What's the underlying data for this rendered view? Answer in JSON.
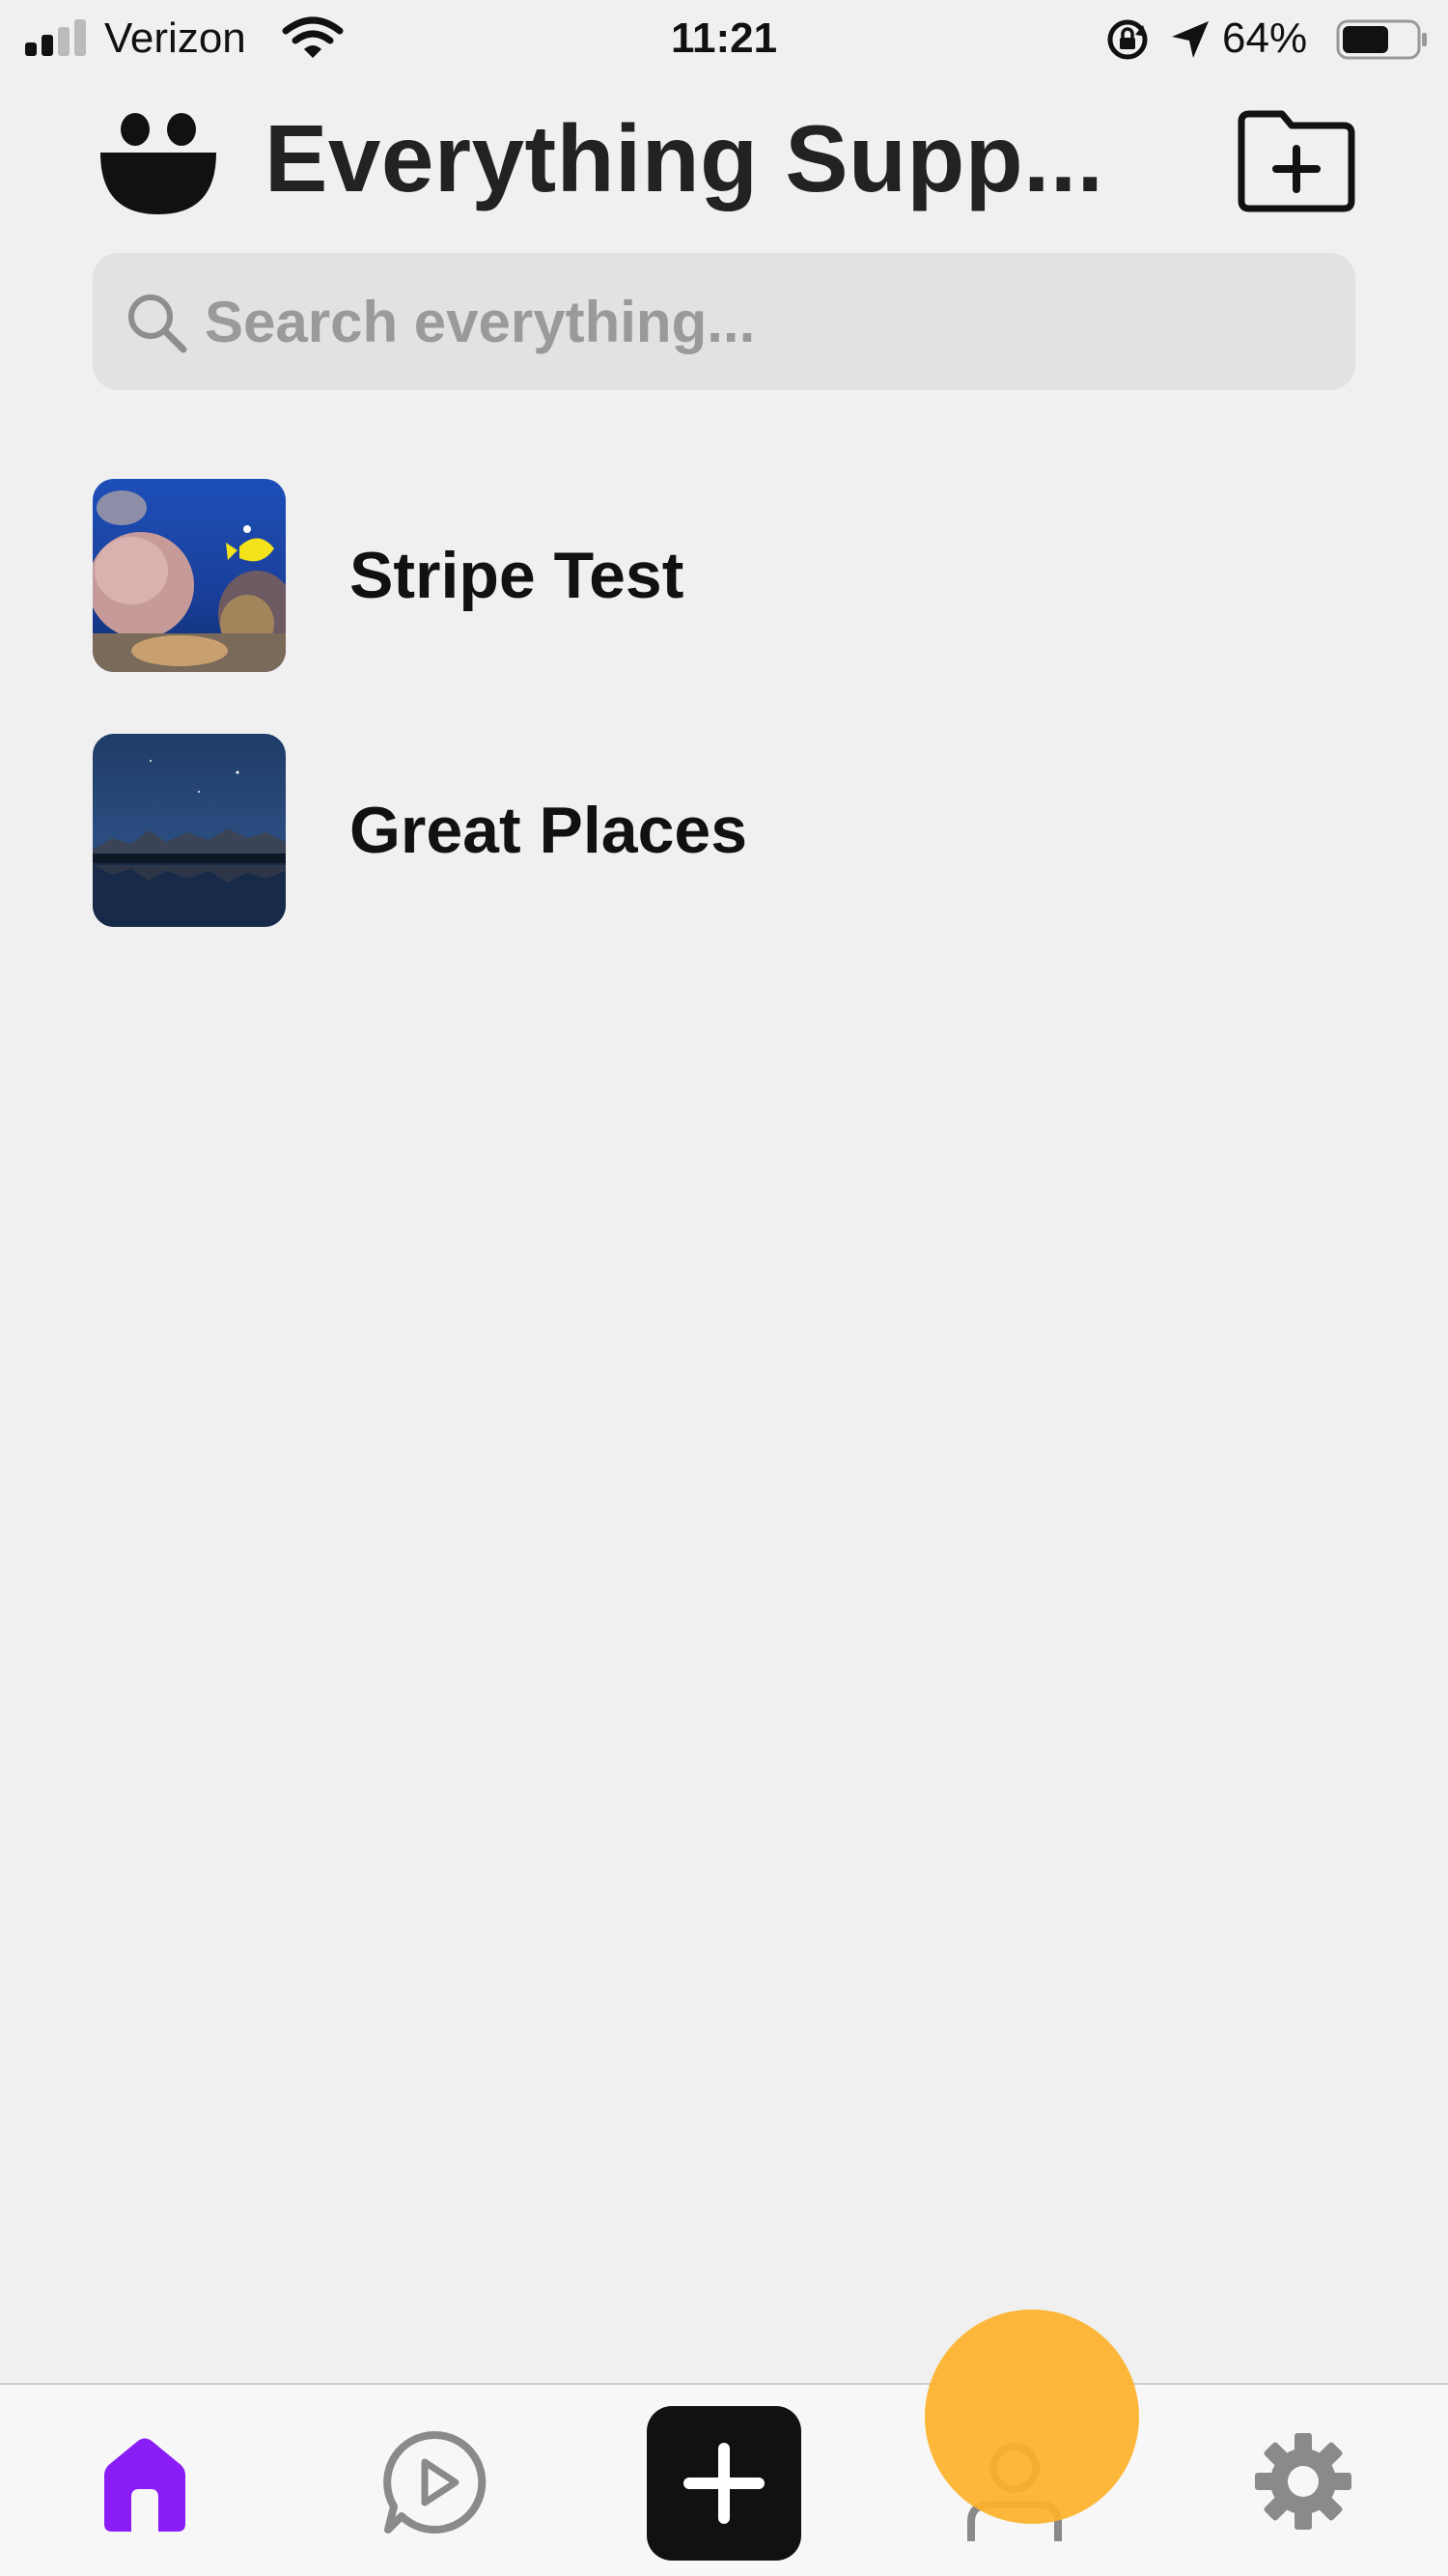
{
  "status_bar": {
    "carrier": "Verizon",
    "time": "11:21",
    "battery_percent": "64%",
    "battery_level": 0.64,
    "icons": [
      "signal-icon",
      "wifi-icon",
      "rotation-lock-icon",
      "location-icon",
      "battery-icon"
    ]
  },
  "header": {
    "title": "Everything Supp...",
    "logo_icon": "smiley-face-icon",
    "new_folder_icon": "folder-plus-icon"
  },
  "search": {
    "placeholder": "Search everything...",
    "value": ""
  },
  "collections": [
    {
      "label": "Stripe Test",
      "thumbnail": "coral-reef-fish-thumbnail"
    },
    {
      "label": "Great Places",
      "thumbnail": "night-mountain-lake-thumbnail"
    }
  ],
  "tab_bar": {
    "active_tab": "home",
    "tabs": [
      {
        "id": "home",
        "icon": "home-icon"
      },
      {
        "id": "play",
        "icon": "play-chat-icon"
      },
      {
        "id": "add",
        "icon": "plus-icon"
      },
      {
        "id": "profile",
        "icon": "person-icon"
      },
      {
        "id": "settings",
        "icon": "gear-icon"
      }
    ]
  },
  "colors": {
    "background": "#f0f0f0",
    "accent_active": "#8a1cf5",
    "icon_inactive": "#8a8a8a",
    "touch_indicator": "#fdb22a"
  }
}
